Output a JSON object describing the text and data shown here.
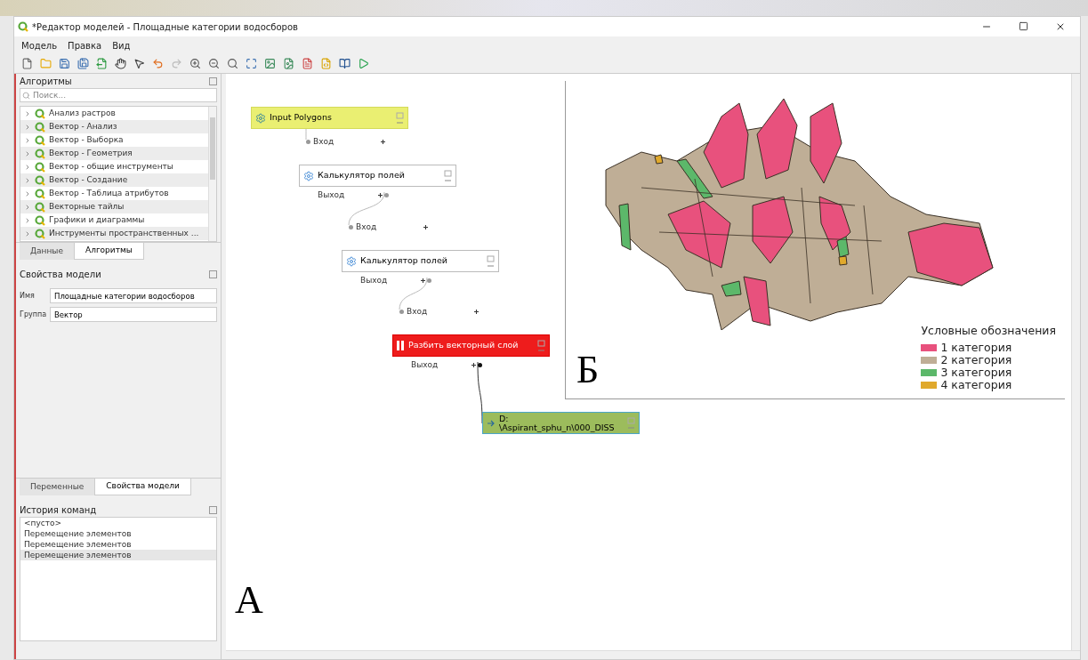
{
  "window": {
    "title": "*Редактор моделей - Площадные категории водосборов"
  },
  "menu": [
    "Модель",
    "Правка",
    "Вид"
  ],
  "algorithms_panel": {
    "title": "Алгоритмы",
    "search": {
      "placeholder": "Поиск..."
    },
    "items": [
      {
        "label": "Анализ растров",
        "expanded": false
      },
      {
        "label": "Вектор - Анализ",
        "expanded": false
      },
      {
        "label": "Вектор - Выборка",
        "expanded": false
      },
      {
        "label": "Вектор - Геометрия",
        "expanded": false
      },
      {
        "label": "Вектор - общие инструменты",
        "expanded": false
      },
      {
        "label": "Вектор - Создание",
        "expanded": false
      },
      {
        "label": "Вектор - Таблица атрибутов",
        "expanded": false
      },
      {
        "label": "Векторные тайлы",
        "expanded": false
      },
      {
        "label": "Графики и диаграммы",
        "expanded": false
      },
      {
        "label": "Инструменты пространственных ...",
        "expanded": false
      }
    ]
  },
  "tabs_top": [
    {
      "label": "Данные",
      "selected": false
    },
    {
      "label": "Алгоритмы",
      "selected": true
    }
  ],
  "model_properties": {
    "title": "Свойства модели",
    "fields": [
      {
        "label": "Имя",
        "value": "Площадные категории водосборов"
      },
      {
        "label": "Группа",
        "value": "Вектор"
      }
    ]
  },
  "tabs_bottom": [
    {
      "label": "Переменные",
      "selected": false
    },
    {
      "label": "Свойства модели",
      "selected": true
    }
  ],
  "history": {
    "title": "История команд",
    "items": [
      {
        "label": "<пусто>",
        "selected": false
      },
      {
        "label": "Перемещение элементов",
        "selected": false
      },
      {
        "label": "Перемещение элементов",
        "selected": false
      },
      {
        "label": "Перемещение элементов",
        "selected": true
      }
    ]
  },
  "canvas": {
    "nodes": [
      {
        "kind": "input",
        "label": "Input Polygons"
      },
      {
        "kind": "algorithm",
        "label": "Калькулятор полей",
        "input": "Вход",
        "output": "Выход"
      },
      {
        "kind": "algorithm",
        "label": "Калькулятор полей",
        "input": "Вход",
        "output": "Выход"
      },
      {
        "kind": "error",
        "label": "Разбить векторный слой",
        "input": "Вход",
        "output": "Выход"
      },
      {
        "kind": "output",
        "label": "D:",
        "label_2": "\\Aspirant_sphu_n\\000_DISS"
      }
    ],
    "figure_labels": [
      "А",
      "Б"
    ]
  },
  "map": {
    "legend": {
      "title": "Условные обозначения",
      "items": [
        {
          "label": "1 категория",
          "color": "#e8517d"
        },
        {
          "label": "2 категория",
          "color": "#bfae96"
        },
        {
          "label": "3 категория",
          "color": "#5cb86a"
        },
        {
          "label": "4 категория",
          "color": "#e0a92c"
        }
      ]
    }
  }
}
